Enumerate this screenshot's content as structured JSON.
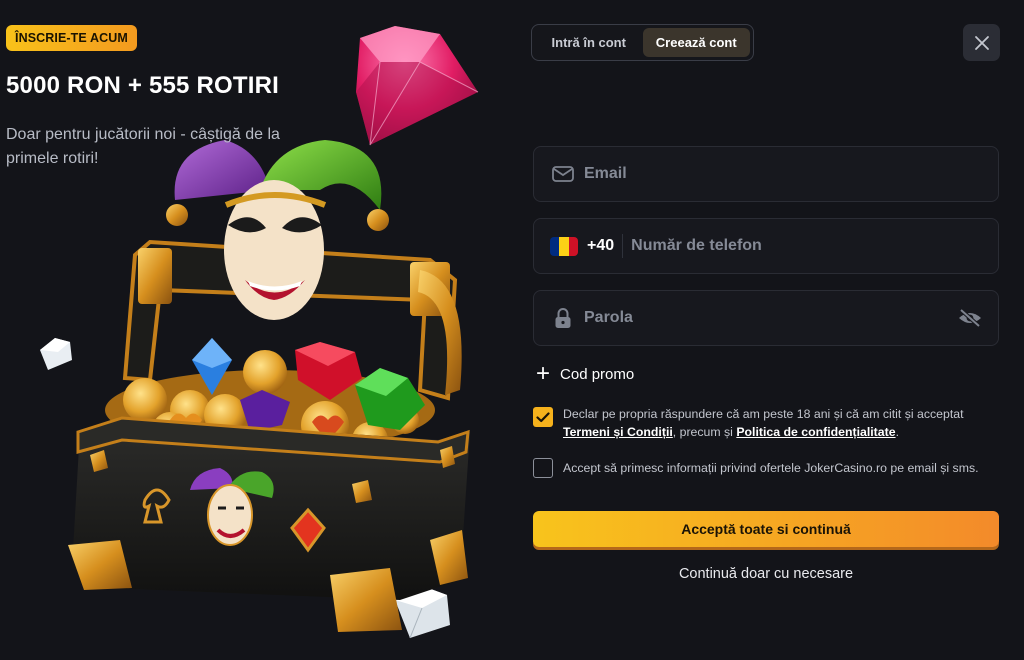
{
  "promo": {
    "badge": "ÎNSCRIE-TE ACUM",
    "title": "5000 RON + 555 ROTIRI",
    "subtitle": "Doar pentru jucătorii noi - câștigă de la primele rotiri!"
  },
  "tabs": [
    {
      "label": "Intră în cont",
      "active": false
    },
    {
      "label": "Creează cont",
      "active": true
    }
  ],
  "form": {
    "email_placeholder": "Email",
    "phone_prefix": "+40",
    "phone_placeholder": "Număr de telefon",
    "password_placeholder": "Parola",
    "promo_code_label": "Cod promo"
  },
  "consents": [
    {
      "checked": true,
      "text_before": "Declar pe propria răspundere că am peste 18 ani și că am citit și acceptat ",
      "link1": "Termeni și Condiții",
      "text_mid": ", precum și ",
      "link2": "Politica de confidențialitate",
      "text_after": "."
    },
    {
      "checked": false,
      "text": "Accept să primesc informații privind ofertele JokerCasino.ro pe email și sms."
    }
  ],
  "actions": {
    "primary": "Acceptă toate si continuă",
    "secondary": "Continuă doar cu necesare"
  },
  "icons": {
    "close": "close-icon",
    "email": "envelope-icon",
    "phone_flag": "romania-flag-icon",
    "password": "lock-icon",
    "eye": "eye-slash-icon",
    "promo": "plus-icon",
    "check": "checkmark-icon"
  },
  "colors": {
    "background": "#131419",
    "accent": "#f6b21c",
    "field_bg": "#17181e",
    "flag_blue": "#002b7f",
    "flag_yellow": "#fcd116",
    "flag_red": "#ce1126"
  }
}
